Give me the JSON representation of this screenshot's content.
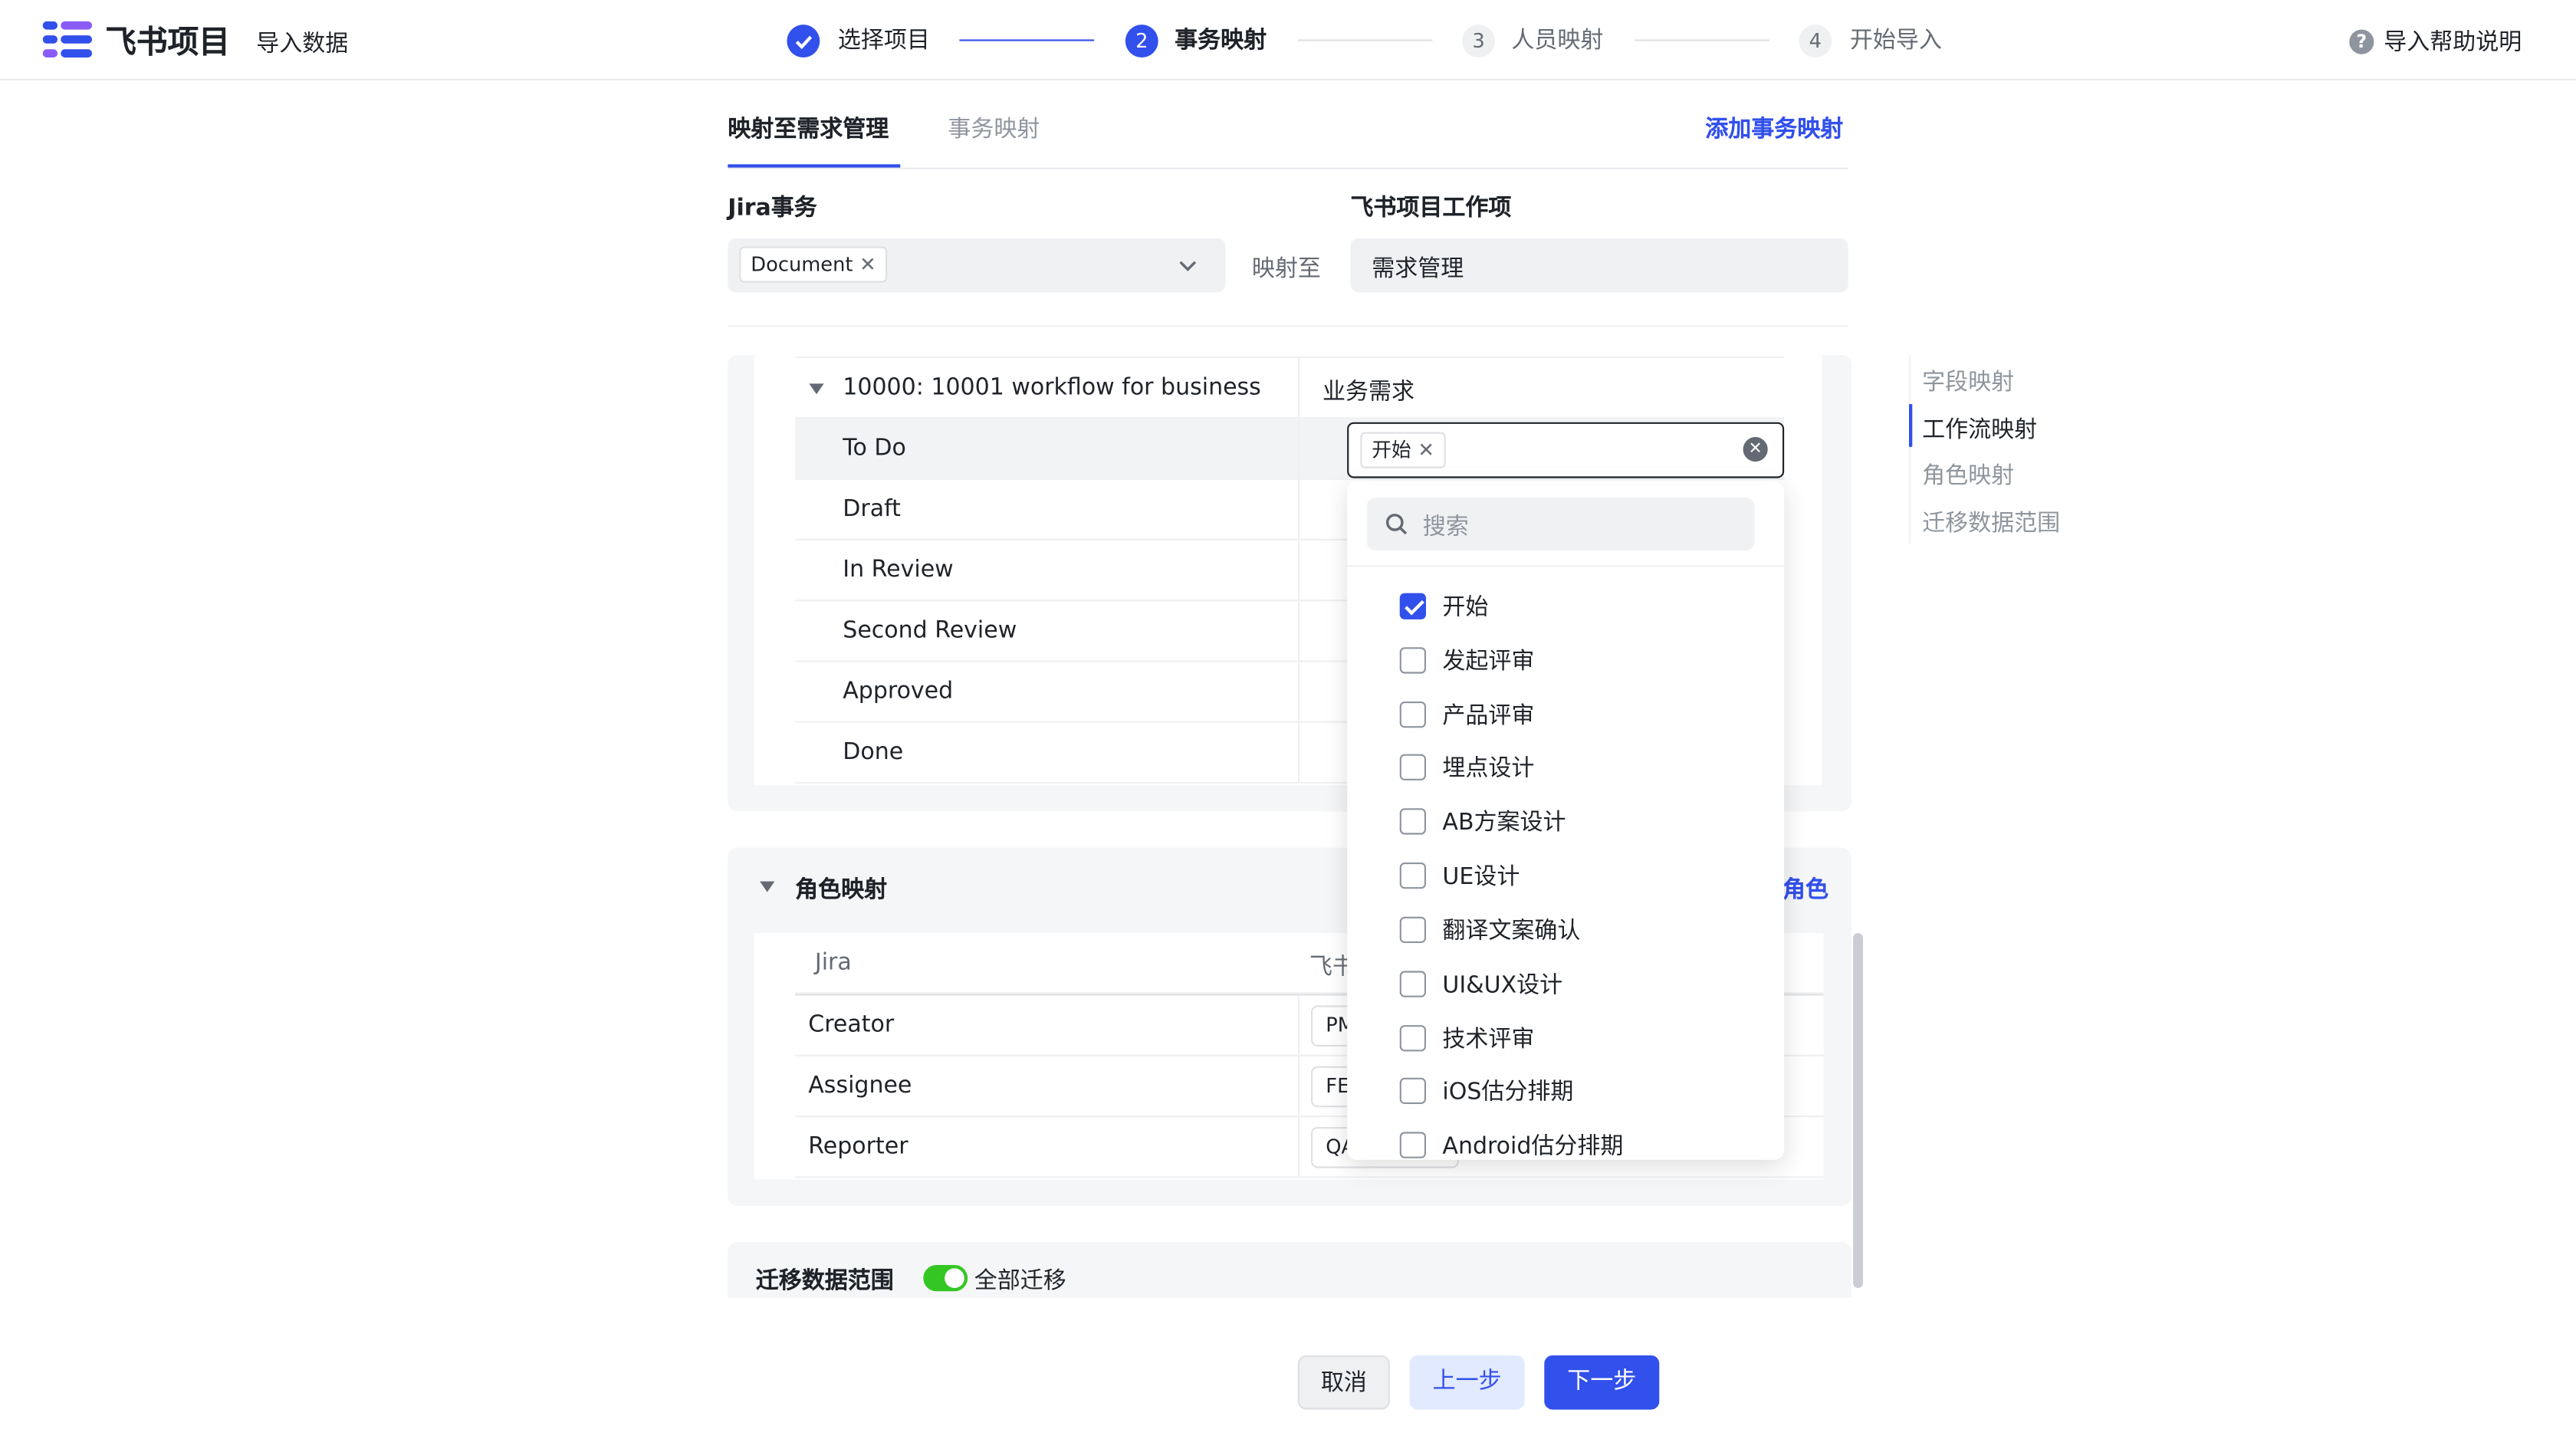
{
  "header": {
    "app_name": "飞书项目",
    "page_name": "导入数据",
    "steps": [
      {
        "num": "✓",
        "label": "选择项目",
        "state": "done"
      },
      {
        "num": "2",
        "label": "事务映射",
        "state": "active"
      },
      {
        "num": "3",
        "label": "人员映射",
        "state": "todo"
      },
      {
        "num": "4",
        "label": "开始导入",
        "state": "todo"
      }
    ],
    "help": "导入帮助说明"
  },
  "tabs": [
    {
      "label": "映射至需求管理",
      "active": true
    },
    {
      "label": "事务映射",
      "active": false
    }
  ],
  "add_mapping": "添加事务映射",
  "mapping": {
    "jira_label": "Jira事务",
    "jira_chip": "Document",
    "maps_to": "映射至",
    "target_label": "飞书项目工作项",
    "target_value": "需求管理"
  },
  "workflow": {
    "group_name": "10000: 10001 workflow for business",
    "group_target": "业务需求",
    "rows": [
      "To Do",
      "Draft",
      "In Review",
      "Second Review",
      "Approved",
      "Done"
    ],
    "selected_chip": "开始"
  },
  "dropdown": {
    "search_placeholder": "搜索",
    "options": [
      {
        "label": "开始",
        "checked": true
      },
      {
        "label": "发起评审",
        "checked": false
      },
      {
        "label": "产品评审",
        "checked": false
      },
      {
        "label": "埋点设计",
        "checked": false
      },
      {
        "label": "AB方案设计",
        "checked": false
      },
      {
        "label": "UE设计",
        "checked": false
      },
      {
        "label": "翻译文案确认",
        "checked": false
      },
      {
        "label": "UI&UX设计",
        "checked": false
      },
      {
        "label": "技术评审",
        "checked": false
      },
      {
        "label": "iOS估分排期",
        "checked": false
      },
      {
        "label": "Android估分排期",
        "checked": false
      }
    ]
  },
  "roles": {
    "title": "角色映射",
    "add_role_partial": "角色",
    "col_jira": "Jira",
    "col_target_partial": "飞书",
    "rows": [
      {
        "name": "Creator",
        "value": "PM"
      },
      {
        "name": "Assignee",
        "value": "FE"
      },
      {
        "name": "Reporter",
        "value": "QA"
      }
    ]
  },
  "range": {
    "label": "迁移数据范围",
    "toggle_label": "全部迁移",
    "toggle_on": true
  },
  "anchors": [
    {
      "label": "字段映射",
      "active": false
    },
    {
      "label": "工作流映射",
      "active": true
    },
    {
      "label": "角色映射",
      "active": false
    },
    {
      "label": "迁移数据范围",
      "active": false
    }
  ],
  "buttons": {
    "cancel": "取消",
    "prev": "上一步",
    "next": "下一步"
  },
  "colors": {
    "primary": "#3250eb",
    "toggle_on": "#34c724",
    "panel_bg": "#f5f6f7"
  }
}
